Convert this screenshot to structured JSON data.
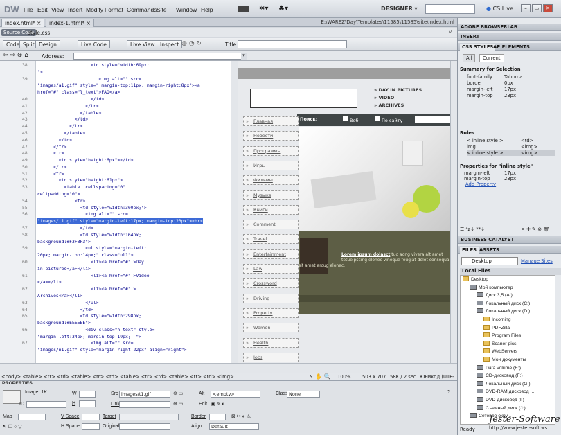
{
  "app": {
    "logo": "DW",
    "menus": [
      "File",
      "Edit",
      "View",
      "Insert",
      "Modify",
      "Format",
      "Commands",
      "Site",
      "Window",
      "Help"
    ],
    "workspace": "DESIGNER",
    "cs_live": "CS Live"
  },
  "doc_tabs": [
    "index.html*",
    "index-1.html*"
  ],
  "doc_path": "E:\\WAREZ\\Day\\Templates\\11585\\11585\\site\\index.html",
  "source_tabs": {
    "source_label": "Source Code",
    "file": "style.css"
  },
  "view_bar": {
    "buttons": [
      "Code",
      "Split",
      "Design",
      "Live Code",
      "Live View",
      "Inspect"
    ],
    "title_label": "Title:"
  },
  "address_label": "Address:",
  "code": {
    "line_numbers": [
      "38",
      "39",
      "40",
      "41",
      "42",
      "43",
      "44",
      "45",
      "46",
      "47",
      "48",
      "49",
      "50",
      "51",
      "52",
      "53",
      "54",
      "55",
      "56",
      "57",
      "58",
      "59",
      "60",
      "61",
      "62",
      "63",
      "64",
      "65",
      "66",
      "67"
    ],
    "lines": [
      {
        "n": "38",
        "indent": "                    ",
        "text": "<td style=\"width:69px;"
      },
      {
        "n": "",
        "indent": "",
        "text": "\">"
      },
      {
        "n": "39",
        "indent": "                       ",
        "text": "<img alt=\"\" src="
      },
      {
        "n": "",
        "indent": "",
        "text": "\"images/a1.gif\" style=\" margin-top:11px; margin-right:8px\"><a"
      },
      {
        "n": "",
        "indent": "",
        "text": "href=\"#\" class=\"l_text\">FAQ</a>"
      },
      {
        "n": "40",
        "indent": "                    ",
        "text": "</td>"
      },
      {
        "n": "41",
        "indent": "                  ",
        "text": "</tr>"
      },
      {
        "n": "42",
        "indent": "                ",
        "text": "</table>"
      },
      {
        "n": "43",
        "indent": "              ",
        "text": "</td>"
      },
      {
        "n": "44",
        "indent": "            ",
        "text": "</tr>"
      },
      {
        "n": "45",
        "indent": "          ",
        "text": "</table>"
      },
      {
        "n": "46",
        "indent": "        ",
        "text": "</td>"
      },
      {
        "n": "47",
        "indent": "      ",
        "text": "</tr>"
      },
      {
        "n": "48",
        "indent": "      ",
        "text": "<tr>"
      },
      {
        "n": "49",
        "indent": "        ",
        "text": "<td style=\"height:6px\"></td>"
      },
      {
        "n": "50",
        "indent": "      ",
        "text": "</tr>"
      },
      {
        "n": "51",
        "indent": "      ",
        "text": "<tr>"
      },
      {
        "n": "52",
        "indent": "        ",
        "text": "<td style=\"height:61px\">"
      },
      {
        "n": "53",
        "indent": "          ",
        "text": "<table  cellspacing=\"0\""
      },
      {
        "n": "",
        "indent": "",
        "text": "cellpadding=\"0\">"
      },
      {
        "n": "54",
        "indent": "              ",
        "text": "<tr>"
      },
      {
        "n": "55",
        "indent": "                ",
        "text": "<td style=\"width:300px;\">"
      },
      {
        "n": "56",
        "indent": "                  ",
        "text": "<img alt=\"\" src="
      },
      {
        "n": "",
        "indent": "",
        "text": "\"images/t1.gif\" style=\"margin-left:17px; margin-top:23px\"><br>",
        "sel": true
      },
      {
        "n": "57",
        "indent": "                ",
        "text": "</td>"
      },
      {
        "n": "58",
        "indent": "                ",
        "text": "<td style=\"width:164px;"
      },
      {
        "n": "",
        "indent": "",
        "text": "background:#F3F3F3\">"
      },
      {
        "n": "59",
        "indent": "                  ",
        "text": "<ul style=\"margin-left:"
      },
      {
        "n": "",
        "indent": "",
        "text": "20px; margin-top:14px;\" class=\"ul1\">"
      },
      {
        "n": "60",
        "indent": "                    ",
        "text": "<li><a href=\"#\" >Day"
      },
      {
        "n": "",
        "indent": "",
        "text": "in pictures</a></li>"
      },
      {
        "n": "61",
        "indent": "                    ",
        "text": "<li><a href=\"#\" >Video"
      },
      {
        "n": "",
        "indent": "",
        "text": "</a></li>"
      },
      {
        "n": "62",
        "indent": "                    ",
        "text": "<li><a href=\"#\" >"
      },
      {
        "n": "",
        "indent": "",
        "text": "Archives</a></li>"
      },
      {
        "n": "63",
        "indent": "                  ",
        "text": "</ul>"
      },
      {
        "n": "64",
        "indent": "                ",
        "text": "</td>"
      },
      {
        "n": "65",
        "indent": "                ",
        "text": "<td style=\"width:298px;"
      },
      {
        "n": "",
        "indent": "",
        "text": "background:#EEEEEE\">"
      },
      {
        "n": "66",
        "indent": "                  ",
        "text": "<div class=\"h_text\" style="
      },
      {
        "n": "",
        "indent": "",
        "text": "\"margin-left:34px; margin-top:19px;  \">"
      },
      {
        "n": "67",
        "indent": "                    ",
        "text": "<img alt=\"\" src="
      },
      {
        "n": "",
        "indent": "",
        "text": "\"images/n1.gif\" style=\"margin-right:22px\" align=\"right\">"
      }
    ]
  },
  "design": {
    "side_links": [
      "Главная",
      "Новости",
      "Программы",
      "Игры",
      "Фильмы",
      "Музыка",
      "Книги",
      "Comment",
      "Travel",
      "Entertainment",
      "Law",
      "Crossword",
      "Driving",
      "Property",
      "Women",
      "Health",
      "Jobs"
    ],
    "list": [
      "» DAY IN PICTURES",
      "» VIDEO",
      "» ARCHIVES"
    ],
    "search_label": "Поиск:",
    "search_opt1": "Веб",
    "search_opt2": "По сайту",
    "caption_link": "Lorem ipsum dolasct",
    "caption_text": " tuo aong vivera alt amet tetueipscing elonec vineque feugiat dolot consequa",
    "caption_text2": "sit amet arcug elonec."
  },
  "status": {
    "tagpath": "<body> <table> <tr> <td> <table> <tr> <td> <table> <tr> <td> <table> <tr> <td> <img>",
    "zoom": "100%",
    "size": "503 x 707",
    "download": "58K / 2 sec",
    "encoding": "Юникод (UTF-8)"
  },
  "props": {
    "title": "PROPERTIES",
    "image_label": "Image, 1K",
    "w_label": "W",
    "h_label": "H",
    "id_label": "ID",
    "src_label": "Src",
    "src_value": "images/t1.gif",
    "link_label": "Link",
    "alt_label": "Alt",
    "alt_value": "<empty>",
    "class_label": "Class",
    "class_value": "None",
    "edit_label": "Edit",
    "map_label": "Map",
    "vspace_label": "V Space",
    "target_label": "Target",
    "border_label": "Border",
    "hspace_label": "H Space",
    "original_label": "Original",
    "align_label": "Align",
    "align_value": "Default"
  },
  "right": {
    "browserlab": "ADOBE BROWSERLAB",
    "insert": "INSERT",
    "css_tabs": [
      "CSS STYLES",
      "AP ELEMENTS"
    ],
    "mode_tabs": [
      "All",
      "Current"
    ],
    "summary_title": "Summary for Selection",
    "summary": [
      [
        "font-family",
        "Tahoma"
      ],
      [
        "border",
        "0px"
      ],
      [
        "margin-left",
        "17px"
      ],
      [
        "margin-top",
        "23px"
      ]
    ],
    "rules_title": "Rules",
    "rules": [
      [
        "< inline style >",
        "<td>"
      ],
      [
        "img",
        "<img>"
      ],
      [
        "< inline style >",
        "<img>"
      ]
    ],
    "props_title": "Properties for \"inline style\"",
    "prop_rows": [
      [
        "margin-left",
        "17px"
      ],
      [
        "margin-top",
        "23px"
      ]
    ],
    "add_property": "Add Property",
    "business": "BUSINESS CATALYST",
    "files_tabs": [
      "FILES",
      "ASSETS"
    ],
    "site_select": "Desktop",
    "manage": "Manage Sites",
    "local_files": "Local Files",
    "tree": [
      {
        "t": "Desktop",
        "lvl": 0,
        "k": "f"
      },
      {
        "t": "Мой компьютер",
        "lvl": 1,
        "k": "d"
      },
      {
        "t": "Диск 3,5 (A:)",
        "lvl": 2,
        "k": "d"
      },
      {
        "t": "Локальный диск (C:)",
        "lvl": 2,
        "k": "d"
      },
      {
        "t": "Локальный диск (D:)",
        "lvl": 2,
        "k": "d"
      },
      {
        "t": "Incoming",
        "lvl": 3,
        "k": "f"
      },
      {
        "t": "PDFZilla",
        "lvl": 3,
        "k": "f"
      },
      {
        "t": "Program Files",
        "lvl": 3,
        "k": "f"
      },
      {
        "t": "Scaner pics",
        "lvl": 3,
        "k": "f"
      },
      {
        "t": "WebServers",
        "lvl": 3,
        "k": "f"
      },
      {
        "t": "Мои документы",
        "lvl": 3,
        "k": "f"
      },
      {
        "t": "Data volume (E:)",
        "lvl": 2,
        "k": "d"
      },
      {
        "t": "CD-дисковод (F:)",
        "lvl": 2,
        "k": "d"
      },
      {
        "t": "Локальный диск (G:)",
        "lvl": 2,
        "k": "d"
      },
      {
        "t": "DVD-RAM дисковод ...",
        "lvl": 2,
        "k": "d"
      },
      {
        "t": "DVD-дисковод (I:)",
        "lvl": 2,
        "k": "d"
      },
      {
        "t": "Съемный диск (J:)",
        "lvl": 2,
        "k": "d"
      },
      {
        "t": "Сетевое окру...",
        "lvl": 1,
        "k": "d"
      }
    ],
    "ready": "Ready"
  },
  "watermark": {
    "text": "Jester-Software",
    "url": "http://www.jester-soft.ws"
  }
}
